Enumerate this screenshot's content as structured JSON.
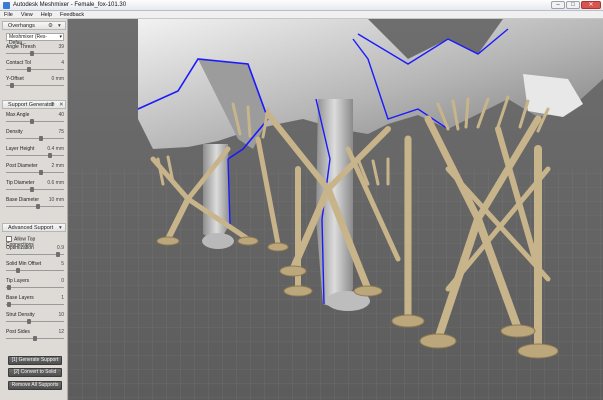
{
  "window": {
    "title": "Autodesk Meshmixer - Female_fox-101.30",
    "minimize": "–",
    "maximize": "□",
    "close": "✕"
  },
  "menu": {
    "file": "File",
    "view": "View",
    "help": "Help",
    "feedback": "Feedback"
  },
  "overhangs": {
    "header": "Overhangs",
    "preset": "Meshmixer (Res-Defau...",
    "angle_thresh": {
      "label": "Angle Thresh",
      "value": "39",
      "fraction": 0.45
    },
    "contact_tol": {
      "label": "Contact Tol",
      "value": "4",
      "fraction": 0.4
    },
    "y_offset": {
      "label": "Y-Offset",
      "value": "0",
      "unit": "mm",
      "fraction": 0.1
    }
  },
  "support_generator": {
    "header": "Support Generator",
    "max_angle": {
      "label": "Max Angle",
      "value": "40",
      "fraction": 0.45
    },
    "density": {
      "label": "Density",
      "value": "75",
      "fraction": 0.6
    },
    "layer_height": {
      "label": "Layer Height",
      "value": "0.4",
      "unit": "mm",
      "fraction": 0.75
    },
    "post_diameter": {
      "label": "Post Diameter",
      "value": "2",
      "unit": "mm",
      "fraction": 0.6
    },
    "tip_diameter": {
      "label": "Tip Diameter",
      "value": "0.6",
      "unit": "mm",
      "fraction": 0.45
    },
    "base_diameter": {
      "label": "Base Diameter",
      "value": "10",
      "unit": "mm",
      "fraction": 0.55
    }
  },
  "advanced_support": {
    "header": "Advanced Support",
    "allow_top_connections": "Allow Top Connections",
    "optimization": {
      "label": "Optimization",
      "value": "0.9",
      "fraction": 0.9
    },
    "solid_min_offset": {
      "label": "Solid Min Offset",
      "value": "5",
      "fraction": 0.2
    },
    "tip_layers": {
      "label": "Tip Layers",
      "value": "0",
      "fraction": 0.05
    },
    "base_layers": {
      "label": "Base Layers",
      "value": "1",
      "fraction": 0.05
    },
    "strut_density": {
      "label": "Strut Density",
      "value": "10",
      "fraction": 0.4
    },
    "post_sides": {
      "label": "Post Sides",
      "value": "12",
      "fraction": 0.5
    }
  },
  "actions": {
    "generate": "[1] Generate Support",
    "convert": "[2] Convert to Solid",
    "remove": "Remove All Supports"
  },
  "icons": {
    "settings": "⚙",
    "close": "✕",
    "chevron": "▾"
  },
  "colors": {
    "support": "#c8b48a",
    "mesh": "#a9a9a9",
    "overhang_outline": "#1a1aff",
    "grid_bg": "#6a6a6a"
  }
}
